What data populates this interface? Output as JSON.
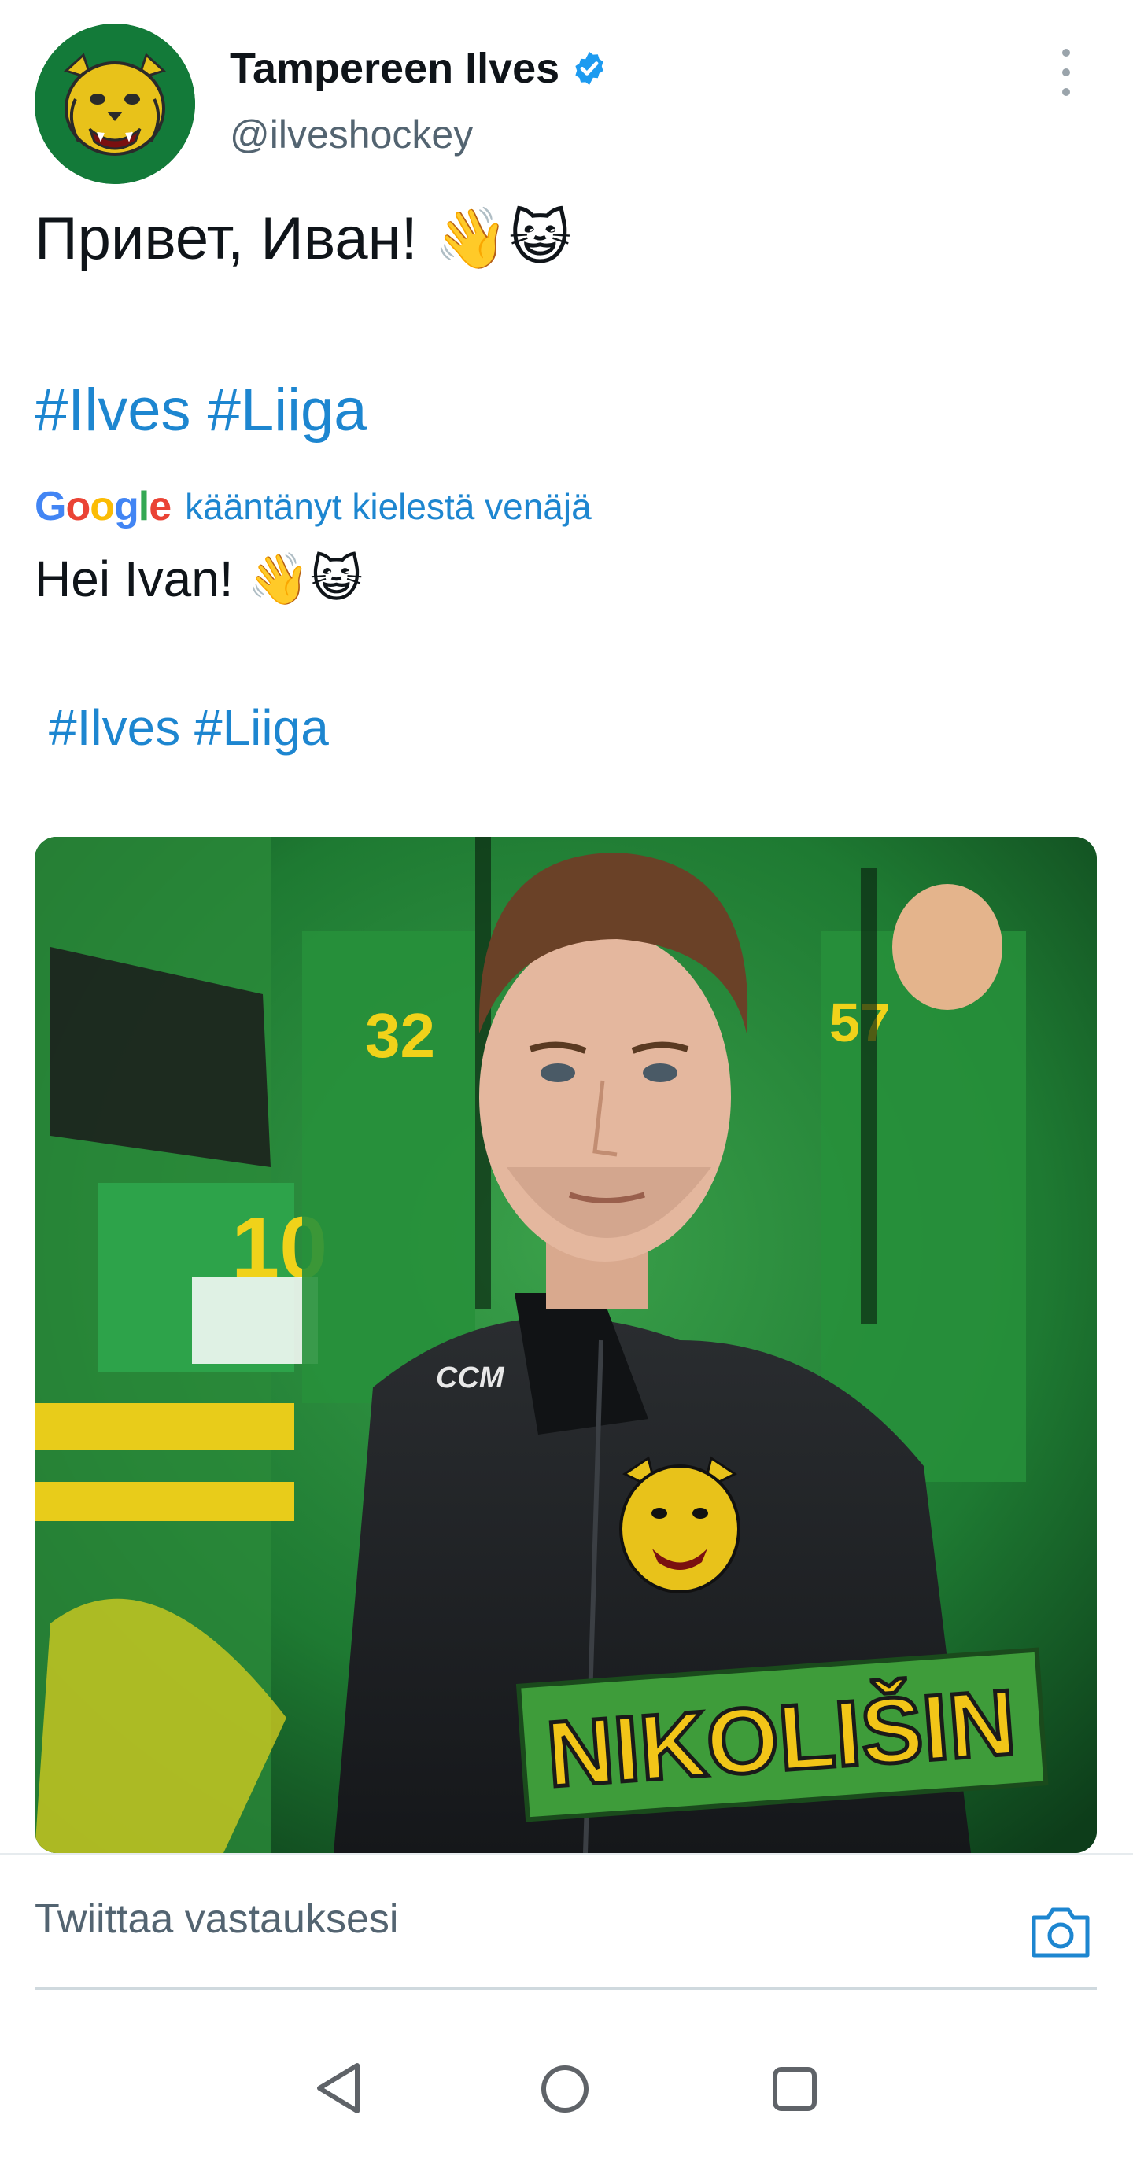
{
  "author": {
    "display_name": "Tampereen Ilves",
    "handle": "@ilveshockey",
    "verified": true,
    "avatar_bg": "#137a39"
  },
  "tweet": {
    "text": "Привет, Иван! 👋😺",
    "hashtags": [
      "#Ilves",
      "#Liiga"
    ]
  },
  "translation": {
    "provider_logo": "Google",
    "label": "kääntänyt kielestä venäjä",
    "text": "Hei Ivan! 👋😺",
    "hashtags": [
      "#Ilves",
      "#Liiga"
    ]
  },
  "media": {
    "jersey_nameplate": "NIKOLIŠIN",
    "brand_mark": "CCM",
    "background_color": "#1f6b2d"
  },
  "reply": {
    "placeholder": "Twiittaa vastauksesi"
  },
  "icons": {
    "more": "more-vertical-icon",
    "verified": "verified-badge-icon",
    "camera": "camera-icon",
    "nav_back": "back-triangle-icon",
    "nav_home": "home-circle-icon",
    "nav_recent": "recent-apps-square-icon"
  },
  "colors": {
    "link": "#1d86d0",
    "verified": "#1d9bf0",
    "text": "#0f1419",
    "secondary": "#536471"
  }
}
